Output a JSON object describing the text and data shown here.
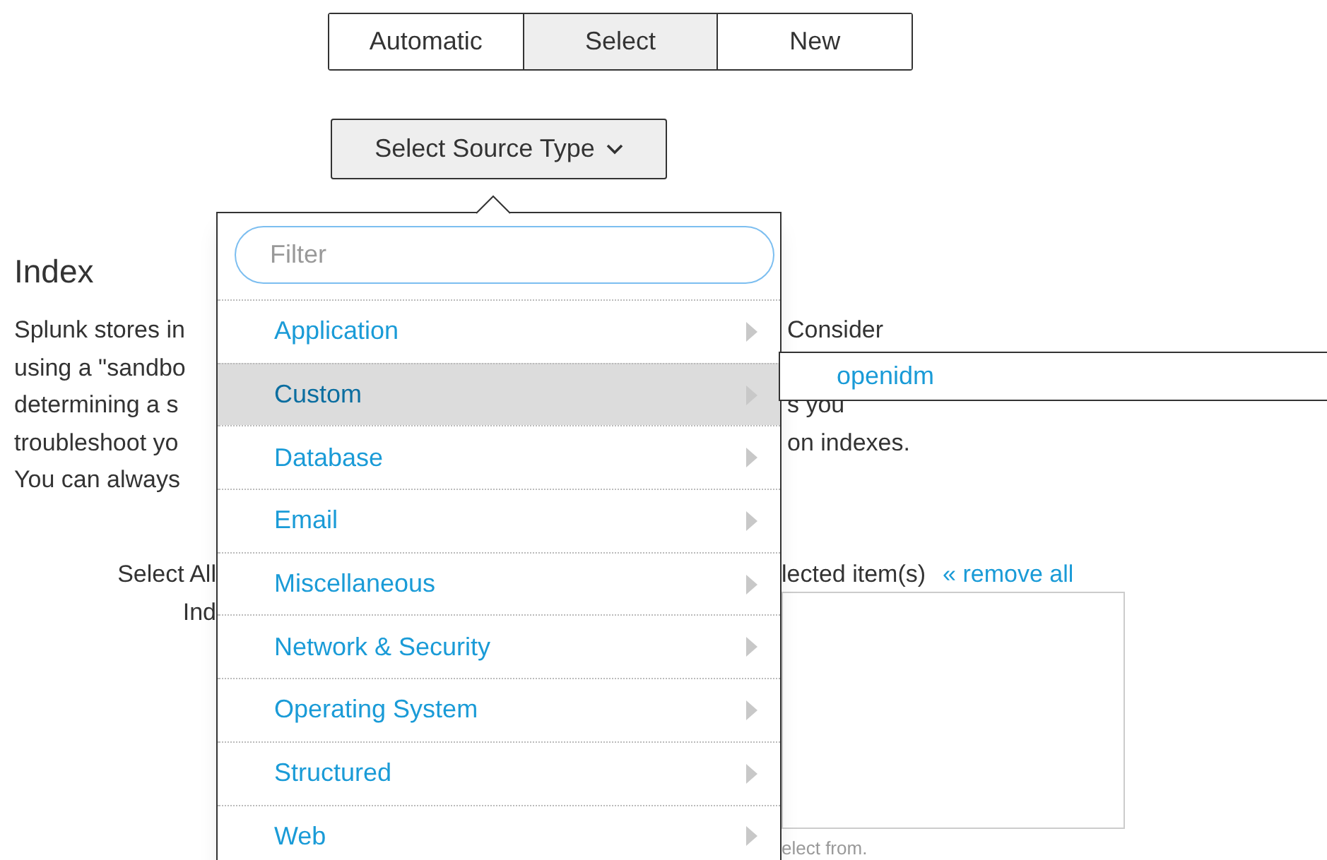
{
  "mode_tabs": [
    {
      "label": "Automatic",
      "selected": false
    },
    {
      "label": "Select",
      "selected": true
    },
    {
      "label": "New",
      "selected": false
    }
  ],
  "source_type_button": {
    "label": "Select Source Type"
  },
  "index_heading": "Index",
  "description_lines": [
    {
      "left": "Splunk stores in",
      "right": "Consider"
    },
    {
      "left": "using a \"sandbo"
    },
    {
      "left": "determining a s",
      "right": "s you"
    },
    {
      "left": "troubleshoot yo",
      "right": "on indexes."
    },
    {
      "left": "You can always"
    }
  ],
  "select_all_label": "Select All",
  "index_label": "Ind",
  "selected_items_label": "lected item(s)",
  "remove_all_link": "« remove all",
  "help_text": "elect from.",
  "menu": {
    "filter": {
      "placeholder": "Filter"
    },
    "items": [
      {
        "label": "Application",
        "selected": false
      },
      {
        "label": "Custom",
        "selected": true
      },
      {
        "label": "Database",
        "selected": false
      },
      {
        "label": "Email",
        "selected": false
      },
      {
        "label": "Miscellaneous",
        "selected": false
      },
      {
        "label": "Network & Security",
        "selected": false
      },
      {
        "label": "Operating System",
        "selected": false
      },
      {
        "label": "Structured",
        "selected": false
      },
      {
        "label": "Web",
        "selected": false
      }
    ]
  },
  "submenu": {
    "items": [
      {
        "label": "openidm"
      }
    ]
  }
}
